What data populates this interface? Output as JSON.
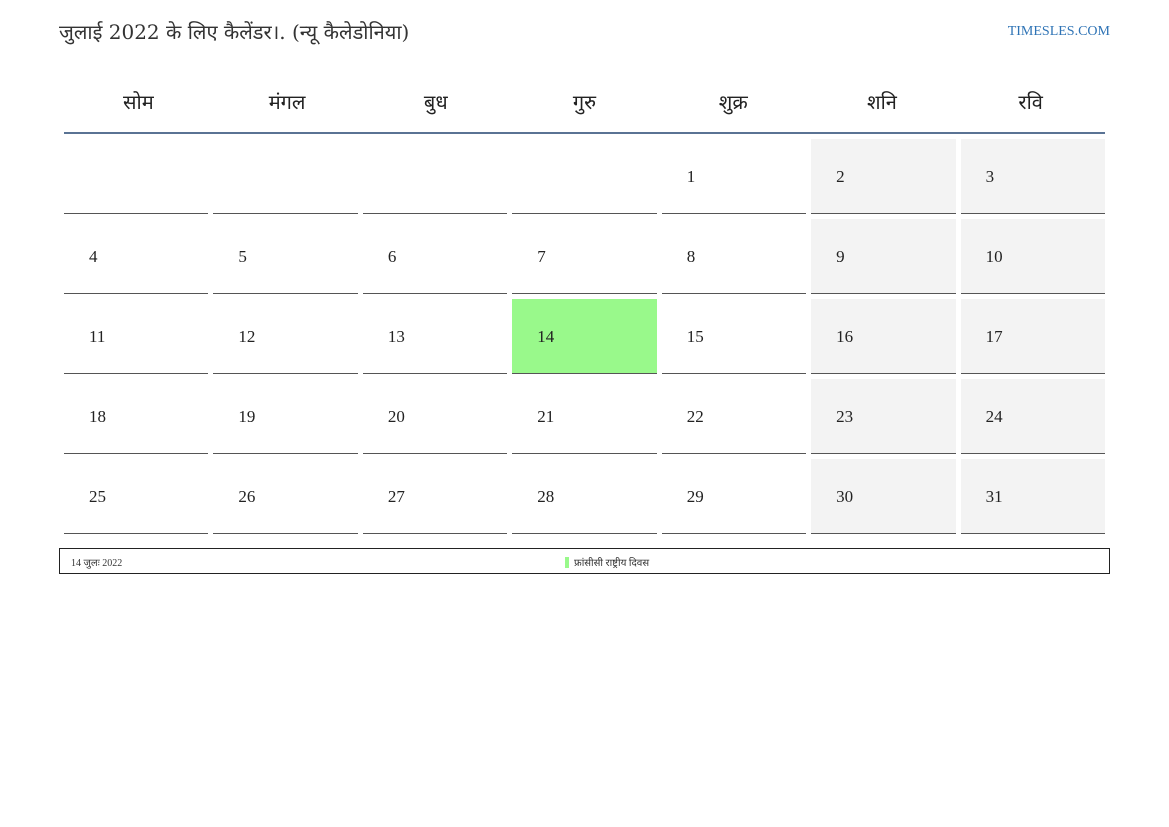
{
  "header": {
    "title": "जुलाई 2022 के लिए कैलेंडर।. (न्यू कैलेडोनिया)",
    "site": "TIMESLES.COM"
  },
  "weekdays": [
    "सोम",
    "मंगल",
    "बुध",
    "गुरु",
    "शुक्र",
    "शनि",
    "रवि"
  ],
  "weeks": [
    [
      "",
      "",
      "",
      "",
      "1",
      "2",
      "3"
    ],
    [
      "4",
      "5",
      "6",
      "7",
      "8",
      "9",
      "10"
    ],
    [
      "11",
      "12",
      "13",
      "14",
      "15",
      "16",
      "17"
    ],
    [
      "18",
      "19",
      "20",
      "21",
      "22",
      "23",
      "24"
    ],
    [
      "25",
      "26",
      "27",
      "28",
      "29",
      "30",
      "31"
    ]
  ],
  "holiday_day": "14",
  "legend": {
    "date": "14 जुलः 2022",
    "event": "फ्रांसीसी राष्ट्रीय दिवस"
  },
  "colors": {
    "holiday": "#99f98b",
    "weekend": "#f3f3f3",
    "header_rule": "#5a7394",
    "link": "#2e73b5"
  }
}
